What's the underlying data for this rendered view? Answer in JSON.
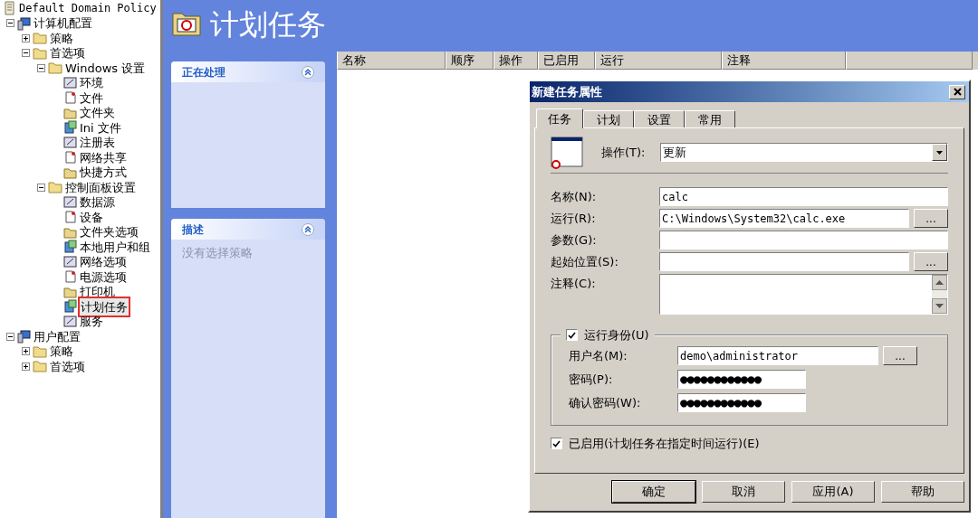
{
  "tree": {
    "label": "Default Domain Policy",
    "children": [
      {
        "label": "计算机配置",
        "expanded": true,
        "selected": false,
        "children": [
          {
            "label": "策略",
            "expanded": false,
            "selected": false
          },
          {
            "label": "首选项",
            "expanded": true,
            "selected": false,
            "children": [
              {
                "label": "Windows 设置",
                "expanded": true,
                "selected": false,
                "children": [
                  {
                    "label": "环境",
                    "selected": false
                  },
                  {
                    "label": "文件",
                    "selected": false
                  },
                  {
                    "label": "文件夹",
                    "selected": false
                  },
                  {
                    "label": "Ini 文件",
                    "selected": false
                  },
                  {
                    "label": "注册表",
                    "selected": false
                  },
                  {
                    "label": "网络共享",
                    "selected": false
                  },
                  {
                    "label": "快捷方式",
                    "selected": false
                  }
                ]
              },
              {
                "label": "控制面板设置",
                "expanded": true,
                "selected": false,
                "children": [
                  {
                    "label": "数据源",
                    "selected": false
                  },
                  {
                    "label": "设备",
                    "selected": false
                  },
                  {
                    "label": "文件夹选项",
                    "selected": false
                  },
                  {
                    "label": "本地用户和组",
                    "selected": false
                  },
                  {
                    "label": "网络选项",
                    "selected": false
                  },
                  {
                    "label": "电源选项",
                    "selected": false
                  },
                  {
                    "label": "打印机",
                    "selected": false
                  },
                  {
                    "label": "计划任务",
                    "selected": true
                  },
                  {
                    "label": "服务",
                    "selected": false
                  }
                ]
              }
            ]
          }
        ]
      },
      {
        "label": "用户配置",
        "expanded": true,
        "selected": false,
        "children": [
          {
            "label": "策略",
            "expanded": false,
            "selected": false
          },
          {
            "label": "首选项",
            "expanded": false,
            "selected": false
          }
        ]
      }
    ]
  },
  "header": {
    "title": "计划任务"
  },
  "task_panels": [
    {
      "title": "正在处理"
    },
    {
      "title": "描述",
      "body": "没有选择策略"
    }
  ],
  "list": {
    "columns": [
      "名称",
      "顺序",
      "操作",
      "已启用",
      "运行",
      "注释"
    ]
  },
  "dialog": {
    "title": "新建任务属性",
    "tabs": [
      {
        "label": "任务",
        "selected": true
      },
      {
        "label": "计划",
        "selected": false
      },
      {
        "label": "设置",
        "selected": false
      },
      {
        "label": "常用",
        "selected": false
      }
    ],
    "action": {
      "label": "操作(T):",
      "value": "更新"
    },
    "fields": [
      {
        "kind": "text",
        "label": "名称(N):",
        "value": "calc"
      },
      {
        "kind": "text",
        "label": "运行(R):",
        "value": "C:\\Windows\\System32\\calc.exe",
        "browse": "..."
      },
      {
        "kind": "text",
        "label": "参数(G):"
      },
      {
        "kind": "text",
        "label": "起始位置(S):",
        "browse": "..."
      },
      {
        "kind": "multiline",
        "label": "注释(C):"
      }
    ],
    "run_as": {
      "label": "运行身份(U)",
      "checked": true,
      "fields": [
        {
          "label": "用户名(M):",
          "value": "demo\\administrator",
          "browse": "..."
        },
        {
          "label": "密码(P):",
          "value": "●●●●●●●●●●●●"
        },
        {
          "label": "确认密码(W):",
          "value": "●●●●●●●●●●●●"
        }
      ]
    },
    "enabled": {
      "label": "已启用(计划任务在指定时间运行)(E)",
      "checked": true
    },
    "buttons": [
      "确定",
      "取消",
      "应用(A)",
      "帮助"
    ]
  }
}
